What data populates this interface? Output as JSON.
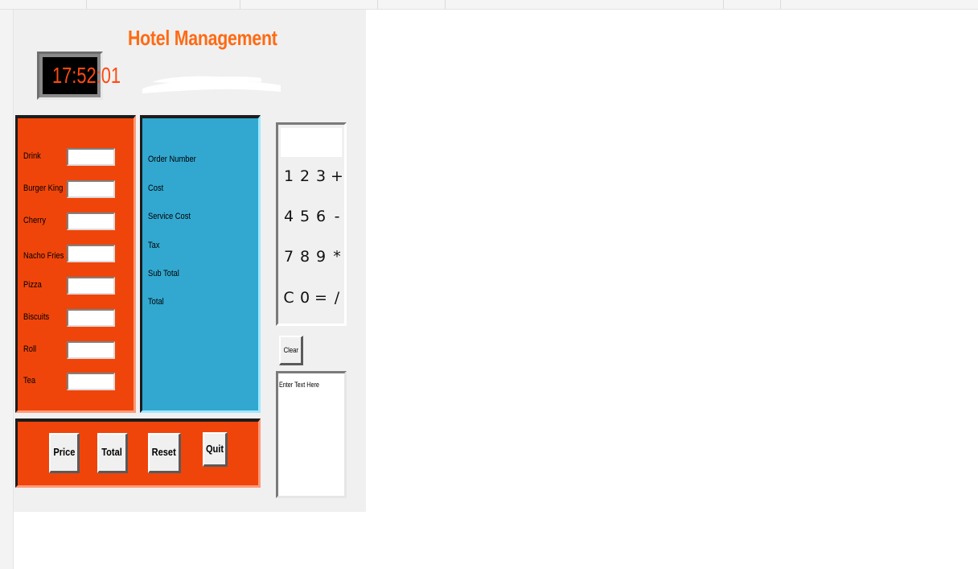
{
  "app": {
    "title": "Hotel Management",
    "clock": "17:52:01",
    "accent_color": "#ff6a13",
    "menu_panel_color": "#f0450a",
    "cost_panel_color": "#32a8d0"
  },
  "menu_items": [
    {
      "label": "Drink",
      "value": ""
    },
    {
      "label": "Burger King",
      "value": ""
    },
    {
      "label": "Cherry",
      "value": ""
    },
    {
      "label": "Nacho Fries",
      "value": ""
    },
    {
      "label": "Pizza",
      "value": ""
    },
    {
      "label": "Biscuits",
      "value": ""
    },
    {
      "label": "Roll",
      "value": ""
    },
    {
      "label": "Tea",
      "value": ""
    }
  ],
  "cost_labels": [
    "Order Number",
    "Cost",
    "Service Cost",
    "Tax",
    "Sub Total",
    "Total"
  ],
  "actions": {
    "price": "Price",
    "total": "Total",
    "reset": "Reset",
    "quit": "Quit"
  },
  "calculator": {
    "display": "",
    "keys": [
      [
        "1",
        "2",
        "3",
        "+"
      ],
      [
        "4",
        "5",
        "6",
        "-"
      ],
      [
        "7",
        "8",
        "9",
        "*"
      ],
      [
        "C",
        "0",
        "=",
        "/"
      ]
    ],
    "clear_label": "Clear"
  },
  "notes": {
    "text": "Enter Text Here"
  }
}
